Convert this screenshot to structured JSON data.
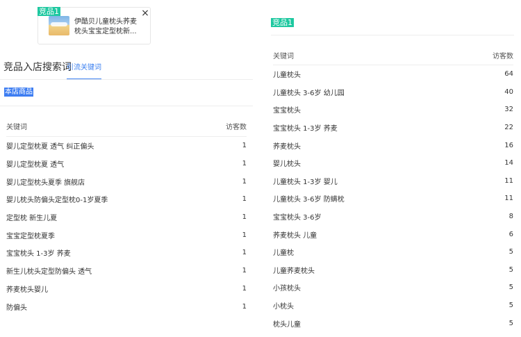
{
  "competitor_card": {
    "tag": "竞品1",
    "title_line1": "伊酷贝儿童枕头荞麦",
    "title_line2": "枕头宝宝定型枕新...",
    "close_symbol": "×"
  },
  "left_panel": {
    "section_title": "竞品入店搜索词",
    "tab_label": "引流关键词",
    "store_tag": "本店商品",
    "columns": {
      "keyword": "关键词",
      "visitors": "访客数"
    },
    "rows": [
      {
        "keyword": "婴儿定型枕夏 透气 纠正偏头",
        "visitors": "1"
      },
      {
        "keyword": "婴儿定型枕夏 透气",
        "visitors": "1"
      },
      {
        "keyword": "婴儿定型枕头夏季 旗舰店",
        "visitors": "1"
      },
      {
        "keyword": "婴儿枕头防偏头定型枕0-1岁夏季",
        "visitors": "1"
      },
      {
        "keyword": "定型枕 新生儿夏",
        "visitors": "1"
      },
      {
        "keyword": "宝宝定型枕夏季",
        "visitors": "1"
      },
      {
        "keyword": "宝宝枕头 1-3岁 荞麦",
        "visitors": "1"
      },
      {
        "keyword": "新生儿枕头定型防偏头 透气",
        "visitors": "1"
      },
      {
        "keyword": "荞麦枕头婴儿",
        "visitors": "1"
      },
      {
        "keyword": "防偏头",
        "visitors": "1"
      }
    ]
  },
  "right_panel": {
    "tag": "竞品1",
    "columns": {
      "keyword": "关键词",
      "visitors": "访客数"
    },
    "rows": [
      {
        "keyword": "儿童枕头",
        "visitors": "64"
      },
      {
        "keyword": "儿童枕头 3-6岁 幼儿园",
        "visitors": "40"
      },
      {
        "keyword": "宝宝枕头",
        "visitors": "32"
      },
      {
        "keyword": "宝宝枕头 1-3岁 荞麦",
        "visitors": "22"
      },
      {
        "keyword": "荞麦枕头",
        "visitors": "16"
      },
      {
        "keyword": "婴儿枕头",
        "visitors": "14"
      },
      {
        "keyword": "儿童枕头 1-3岁 婴儿",
        "visitors": "11"
      },
      {
        "keyword": "儿童枕头 3-6岁 防螨枕",
        "visitors": "11"
      },
      {
        "keyword": "宝宝枕头 3-6岁",
        "visitors": "8"
      },
      {
        "keyword": "荞麦枕头 儿童",
        "visitors": "6"
      },
      {
        "keyword": "儿童枕",
        "visitors": "5"
      },
      {
        "keyword": "儿童荞麦枕头",
        "visitors": "5"
      },
      {
        "keyword": "小孩枕头",
        "visitors": "5"
      },
      {
        "keyword": "小枕头",
        "visitors": "5"
      },
      {
        "keyword": "枕头儿童",
        "visitors": "5"
      }
    ]
  },
  "colors": {
    "tag_green": "#1ec8a0",
    "accent_blue": "#3a7ff0",
    "store_tag_blue": "#3d7df2"
  }
}
